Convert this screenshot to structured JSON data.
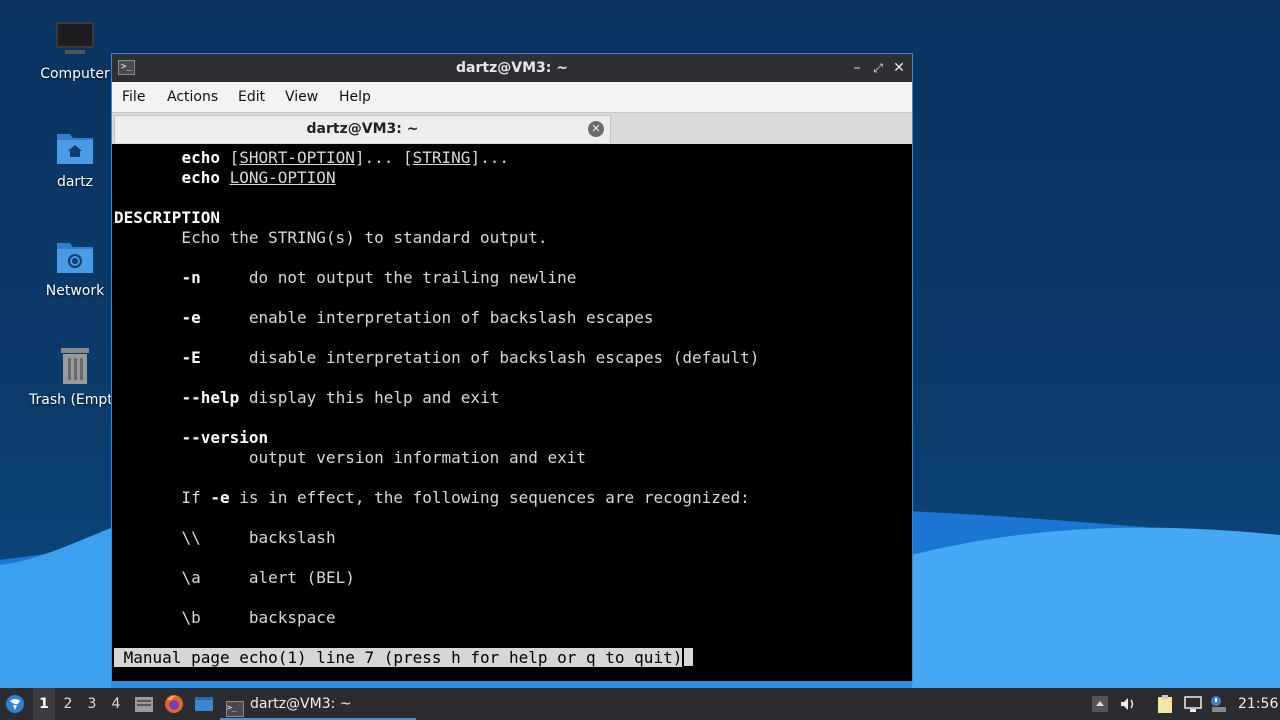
{
  "desktop": {
    "icons": [
      {
        "label": "Computer"
      },
      {
        "label": "dartz"
      },
      {
        "label": "Network"
      },
      {
        "label": "Trash (Empt"
      }
    ]
  },
  "window": {
    "title": "dartz@VM3: ~",
    "menu": [
      "File",
      "Actions",
      "Edit",
      "View",
      "Help"
    ],
    "tab": {
      "label": "dartz@VM3: ~"
    }
  },
  "terminal": {
    "synopsis1": {
      "indent": "       ",
      "cmd": "echo",
      "sp": " ",
      "arg1": "SHORT-OPTION",
      "mid": "]... [",
      "arg2": "STRING",
      "tail": "]...",
      "open": "["
    },
    "synopsis2": {
      "indent": "       ",
      "cmd": "echo",
      "sp": " ",
      "arg": "LONG-OPTION"
    },
    "section": "DESCRIPTION",
    "desc": "       Echo the STRING(s) to standard output.",
    "opts": [
      {
        "flag": "-n",
        "gap": "     ",
        "text": "do not output the trailing newline"
      },
      {
        "flag": "-e",
        "gap": "     ",
        "text": "enable interpretation of backslash escapes"
      },
      {
        "flag": "-E",
        "gap": "     ",
        "text": "disable interpretation of backslash escapes (default)"
      },
      {
        "flag": "--help",
        "gap": " ",
        "text": "display this help and exit"
      }
    ],
    "version_flag": "--version",
    "version_text": "              output version information and exit",
    "if_pre": "       If ",
    "if_flag": "-e",
    "if_post": " is in effect, the following sequences are recognized:",
    "seqs": [
      {
        "seq": "\\\\",
        "gap": "     ",
        "text": "backslash"
      },
      {
        "seq": "\\a",
        "gap": "     ",
        "text": "alert (BEL)"
      },
      {
        "seq": "\\b",
        "gap": "     ",
        "text": "backspace"
      }
    ],
    "status": " Manual page echo(1) line 7 (press h for help or q to quit)"
  },
  "taskbar": {
    "workspaces": [
      "1",
      "2",
      "3",
      "4"
    ],
    "active_workspace": "1",
    "task_label": "dartz@VM3: ~",
    "clock": "21:56"
  }
}
